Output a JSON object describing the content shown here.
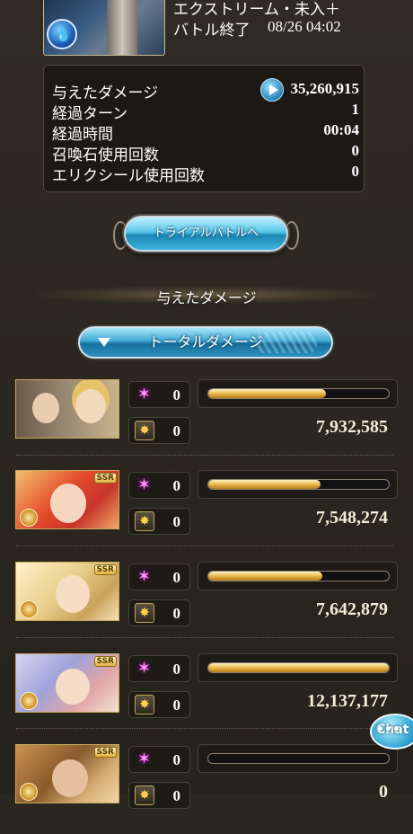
{
  "quest": {
    "name": "エクストリーム・未入＋",
    "status": "バトル終了",
    "date": "08/26 04:02"
  },
  "stats": [
    {
      "label": "与えたダメージ",
      "value": "35,260,915"
    },
    {
      "label": "経過ターン",
      "value": "1"
    },
    {
      "label": "経過時間",
      "value": "00:04"
    },
    {
      "label": "召喚石使用回数",
      "value": "0"
    },
    {
      "label": "エリクシール使用回数",
      "value": "0"
    }
  ],
  "trial_button_label": "トライアルバトルへ",
  "section_title": "与えたダメージ",
  "dropdown_label": "トータルダメージ",
  "characters": [
    {
      "skill_count": "0",
      "ca_count": "0",
      "damage": "7,932,585",
      "bar_fraction": 0.65,
      "ssr": ""
    },
    {
      "skill_count": "0",
      "ca_count": "0",
      "damage": "7,548,274",
      "bar_fraction": 0.62,
      "ssr": "SSR"
    },
    {
      "skill_count": "0",
      "ca_count": "0",
      "damage": "7,642,879",
      "bar_fraction": 0.63,
      "ssr": "SSR"
    },
    {
      "skill_count": "0",
      "ca_count": "0",
      "damage": "12,137,177",
      "bar_fraction": 1.0,
      "ssr": "SSR"
    },
    {
      "skill_count": "0",
      "ca_count": "0",
      "damage": "0",
      "bar_fraction": 0.0,
      "ssr": "SSR"
    }
  ],
  "chat_label": "Chat",
  "icons": {
    "play": "play-icon",
    "skill": "star-icon",
    "charge_attack": "charge-attack-icon",
    "element": "water-element-icon",
    "dropdown": "triangle-down-icon"
  }
}
